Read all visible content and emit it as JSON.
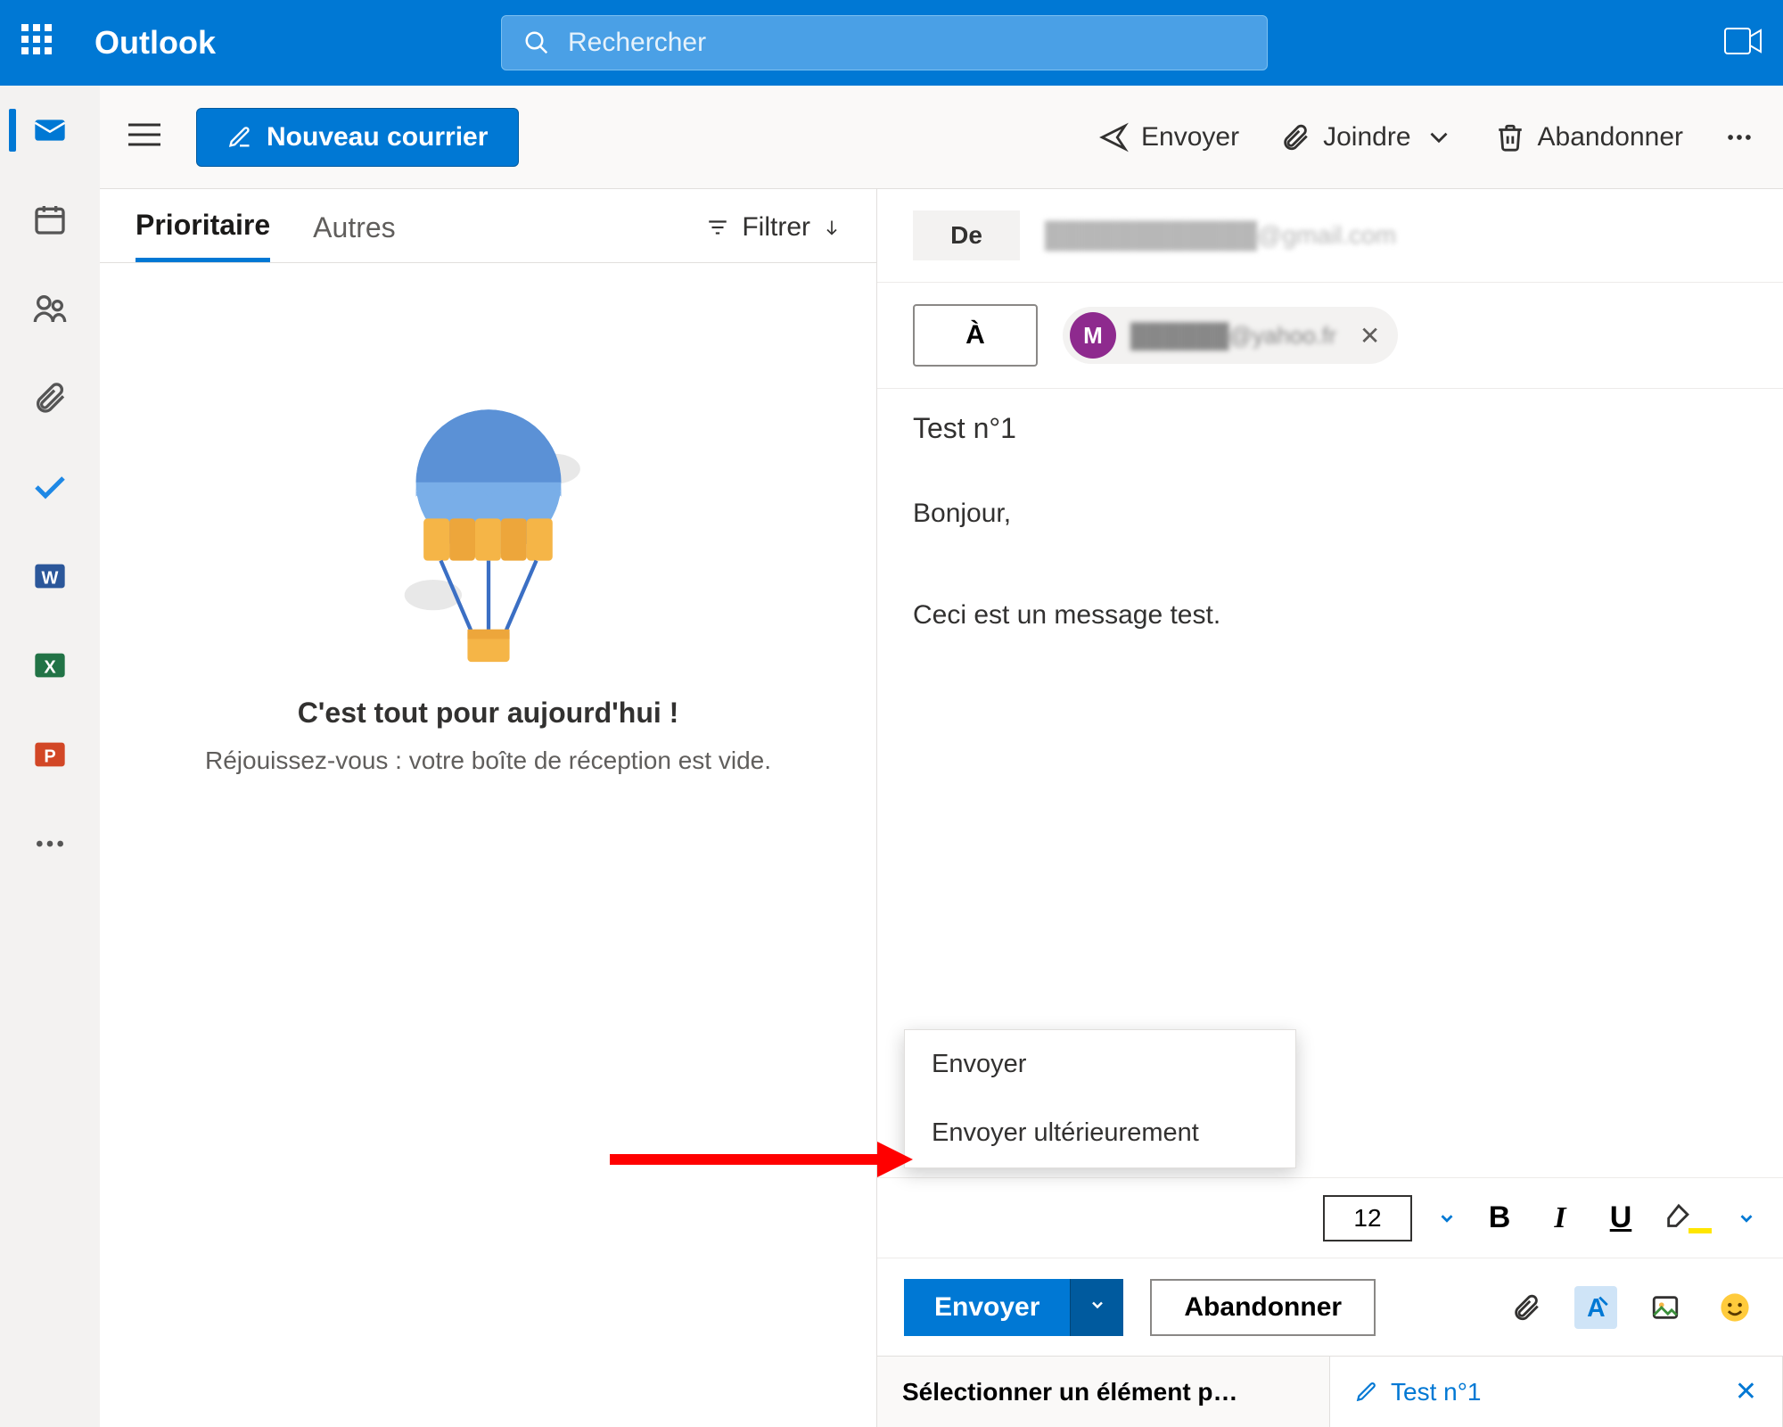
{
  "header": {
    "app_name": "Outlook",
    "search_placeholder": "Rechercher"
  },
  "commandbar": {
    "new_mail": "Nouveau courrier",
    "send": "Envoyer",
    "attach": "Joindre",
    "discard": "Abandonner"
  },
  "listpane": {
    "tab_focused": "Prioritaire",
    "tab_other": "Autres",
    "filter": "Filtrer",
    "empty_title": "C'est tout pour aujourd'hui !",
    "empty_sub": "Réjouissez-vous : votre boîte de réception est vide."
  },
  "compose": {
    "from_label": "De",
    "from_value": "████████████@gmail.com",
    "to_label": "À",
    "to_chip_initial": "M",
    "to_chip_value": "██████@yahoo.fr",
    "subject": "Test n°1",
    "body_line1": "Bonjour,",
    "body_line2": "Ceci est un message test.",
    "send_menu_now": "Envoyer",
    "send_menu_later": "Envoyer ultérieurement",
    "font_size": "12",
    "send_button": "Envoyer",
    "discard_button": "Abandonner"
  },
  "tabstrip": {
    "tab1": "Sélectionner un élément p…",
    "tab2": "Test n°1"
  }
}
